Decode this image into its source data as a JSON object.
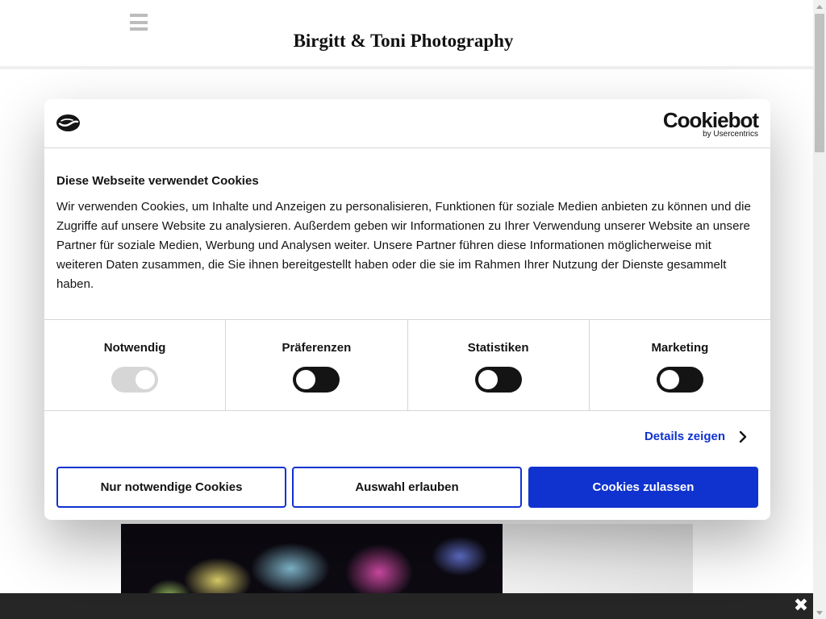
{
  "site": {
    "title": "Birgitt & Toni Photography"
  },
  "cookie_dialog": {
    "brand_name": "Cookiebot",
    "brand_sub": "by Usercentrics",
    "heading": "Diese Webseite verwendet Cookies",
    "text": "Wir verwenden Cookies, um Inhalte und Anzeigen zu personalisieren, Funktionen für soziale Medien anbieten zu können und die Zugriffe auf unsere Website zu analysieren. Außerdem geben wir Informationen zu Ihrer Verwendung unserer Website an unsere Partner für soziale Medien, Werbung und Analysen weiter. Unsere Partner führen diese Informationen möglicherweise mit weiteren Daten zusammen, die Sie ihnen bereitgestellt haben oder die sie im Rahmen Ihrer Nutzung der Dienste gesammelt haben.",
    "categories": [
      {
        "label": "Notwendig",
        "enabled": true,
        "locked": true
      },
      {
        "label": "Präferenzen",
        "enabled": false,
        "locked": false
      },
      {
        "label": "Statistiken",
        "enabled": false,
        "locked": false
      },
      {
        "label": "Marketing",
        "enabled": false,
        "locked": false
      }
    ],
    "details_label": "Details zeigen",
    "buttons": {
      "necessary_only": "Nur notwendige Cookies",
      "allow_selection": "Auswahl erlauben",
      "allow_all": "Cookies zulassen"
    }
  },
  "colors": {
    "accent": "#1032cf",
    "text": "#141414",
    "toggle_off": "#141414",
    "toggle_locked": "#d6d6d6",
    "bottom_bar": "#262626"
  },
  "icons": {
    "menu": "hamburger-menu-icon",
    "logo": "cookiebot-logo-icon",
    "details": "chevron-right-icon",
    "close": "close-icon"
  }
}
